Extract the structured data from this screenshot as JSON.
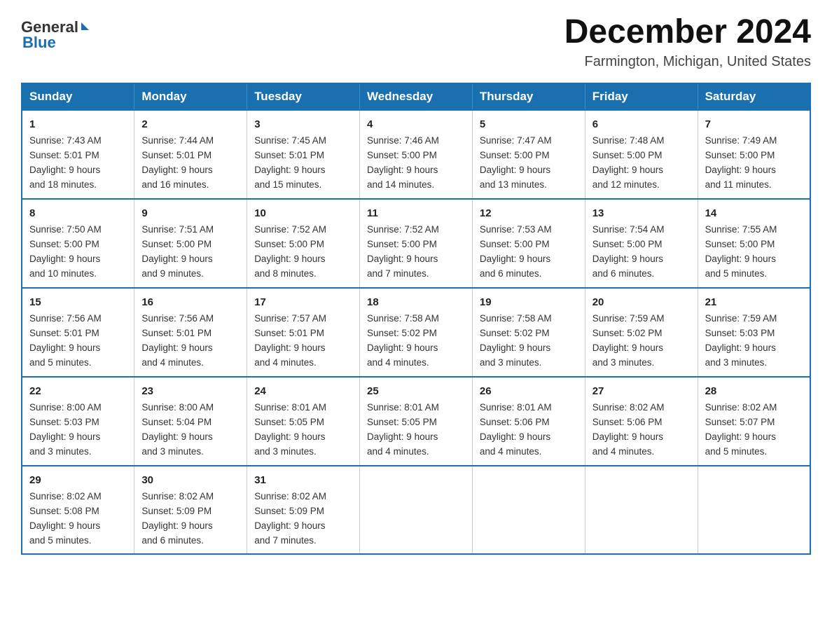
{
  "header": {
    "logo_general": "General",
    "logo_blue": "Blue",
    "month_title": "December 2024",
    "location": "Farmington, Michigan, United States"
  },
  "days_of_week": [
    "Sunday",
    "Monday",
    "Tuesday",
    "Wednesday",
    "Thursday",
    "Friday",
    "Saturday"
  ],
  "weeks": [
    [
      {
        "day": "1",
        "sunrise": "7:43 AM",
        "sunset": "5:01 PM",
        "daylight": "9 hours and 18 minutes."
      },
      {
        "day": "2",
        "sunrise": "7:44 AM",
        "sunset": "5:01 PM",
        "daylight": "9 hours and 16 minutes."
      },
      {
        "day": "3",
        "sunrise": "7:45 AM",
        "sunset": "5:01 PM",
        "daylight": "9 hours and 15 minutes."
      },
      {
        "day": "4",
        "sunrise": "7:46 AM",
        "sunset": "5:00 PM",
        "daylight": "9 hours and 14 minutes."
      },
      {
        "day": "5",
        "sunrise": "7:47 AM",
        "sunset": "5:00 PM",
        "daylight": "9 hours and 13 minutes."
      },
      {
        "day": "6",
        "sunrise": "7:48 AM",
        "sunset": "5:00 PM",
        "daylight": "9 hours and 12 minutes."
      },
      {
        "day": "7",
        "sunrise": "7:49 AM",
        "sunset": "5:00 PM",
        "daylight": "9 hours and 11 minutes."
      }
    ],
    [
      {
        "day": "8",
        "sunrise": "7:50 AM",
        "sunset": "5:00 PM",
        "daylight": "9 hours and 10 minutes."
      },
      {
        "day": "9",
        "sunrise": "7:51 AM",
        "sunset": "5:00 PM",
        "daylight": "9 hours and 9 minutes."
      },
      {
        "day": "10",
        "sunrise": "7:52 AM",
        "sunset": "5:00 PM",
        "daylight": "9 hours and 8 minutes."
      },
      {
        "day": "11",
        "sunrise": "7:52 AM",
        "sunset": "5:00 PM",
        "daylight": "9 hours and 7 minutes."
      },
      {
        "day": "12",
        "sunrise": "7:53 AM",
        "sunset": "5:00 PM",
        "daylight": "9 hours and 6 minutes."
      },
      {
        "day": "13",
        "sunrise": "7:54 AM",
        "sunset": "5:00 PM",
        "daylight": "9 hours and 6 minutes."
      },
      {
        "day": "14",
        "sunrise": "7:55 AM",
        "sunset": "5:00 PM",
        "daylight": "9 hours and 5 minutes."
      }
    ],
    [
      {
        "day": "15",
        "sunrise": "7:56 AM",
        "sunset": "5:01 PM",
        "daylight": "9 hours and 5 minutes."
      },
      {
        "day": "16",
        "sunrise": "7:56 AM",
        "sunset": "5:01 PM",
        "daylight": "9 hours and 4 minutes."
      },
      {
        "day": "17",
        "sunrise": "7:57 AM",
        "sunset": "5:01 PM",
        "daylight": "9 hours and 4 minutes."
      },
      {
        "day": "18",
        "sunrise": "7:58 AM",
        "sunset": "5:02 PM",
        "daylight": "9 hours and 4 minutes."
      },
      {
        "day": "19",
        "sunrise": "7:58 AM",
        "sunset": "5:02 PM",
        "daylight": "9 hours and 3 minutes."
      },
      {
        "day": "20",
        "sunrise": "7:59 AM",
        "sunset": "5:02 PM",
        "daylight": "9 hours and 3 minutes."
      },
      {
        "day": "21",
        "sunrise": "7:59 AM",
        "sunset": "5:03 PM",
        "daylight": "9 hours and 3 minutes."
      }
    ],
    [
      {
        "day": "22",
        "sunrise": "8:00 AM",
        "sunset": "5:03 PM",
        "daylight": "9 hours and 3 minutes."
      },
      {
        "day": "23",
        "sunrise": "8:00 AM",
        "sunset": "5:04 PM",
        "daylight": "9 hours and 3 minutes."
      },
      {
        "day": "24",
        "sunrise": "8:01 AM",
        "sunset": "5:05 PM",
        "daylight": "9 hours and 3 minutes."
      },
      {
        "day": "25",
        "sunrise": "8:01 AM",
        "sunset": "5:05 PM",
        "daylight": "9 hours and 4 minutes."
      },
      {
        "day": "26",
        "sunrise": "8:01 AM",
        "sunset": "5:06 PM",
        "daylight": "9 hours and 4 minutes."
      },
      {
        "day": "27",
        "sunrise": "8:02 AM",
        "sunset": "5:06 PM",
        "daylight": "9 hours and 4 minutes."
      },
      {
        "day": "28",
        "sunrise": "8:02 AM",
        "sunset": "5:07 PM",
        "daylight": "9 hours and 5 minutes."
      }
    ],
    [
      {
        "day": "29",
        "sunrise": "8:02 AM",
        "sunset": "5:08 PM",
        "daylight": "9 hours and 5 minutes."
      },
      {
        "day": "30",
        "sunrise": "8:02 AM",
        "sunset": "5:09 PM",
        "daylight": "9 hours and 6 minutes."
      },
      {
        "day": "31",
        "sunrise": "8:02 AM",
        "sunset": "5:09 PM",
        "daylight": "9 hours and 7 minutes."
      },
      null,
      null,
      null,
      null
    ]
  ],
  "labels": {
    "sunrise": "Sunrise:",
    "sunset": "Sunset:",
    "daylight": "Daylight: 9 hours"
  }
}
